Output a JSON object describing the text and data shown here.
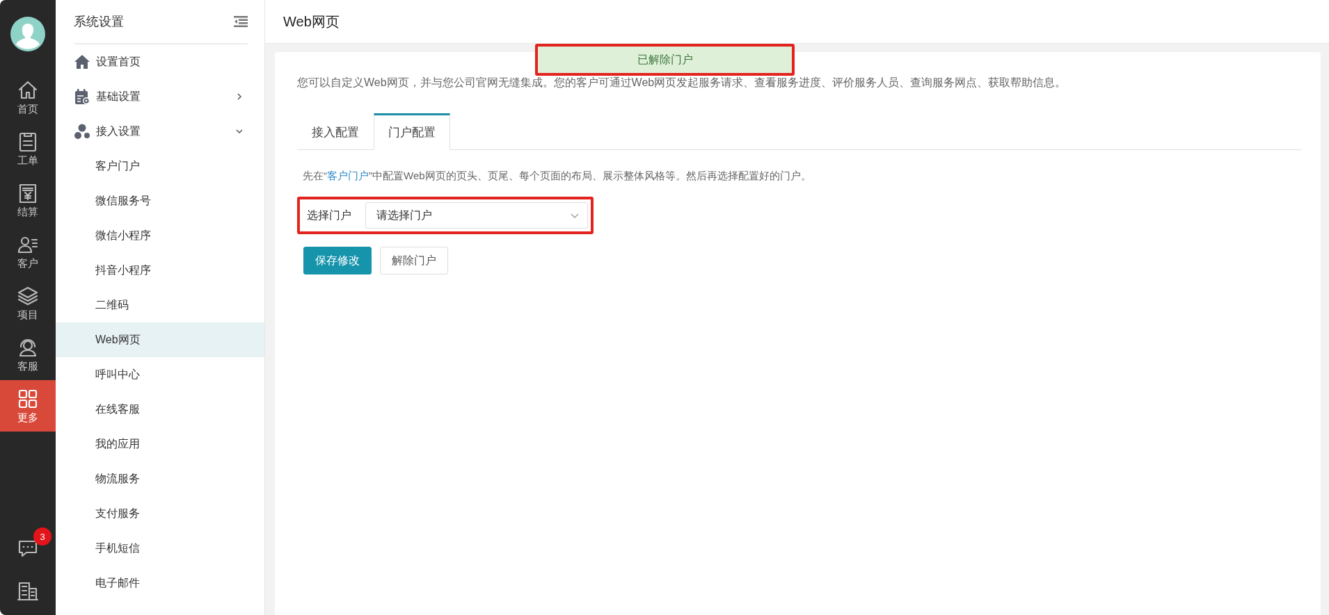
{
  "rail": {
    "items": [
      {
        "label": "首页",
        "kind": "home",
        "selected": false
      },
      {
        "label": "工单",
        "kind": "clipboard",
        "selected": false
      },
      {
        "label": "结算",
        "kind": "invoice",
        "selected": false
      },
      {
        "label": "客户",
        "kind": "customer",
        "selected": false
      },
      {
        "label": "项目",
        "kind": "layers",
        "selected": false
      },
      {
        "label": "客服",
        "kind": "headset",
        "selected": false
      },
      {
        "label": "更多",
        "kind": "grid",
        "selected": true
      }
    ],
    "bottom": [
      {
        "kind": "chat",
        "badge": "3"
      },
      {
        "kind": "building"
      }
    ]
  },
  "sidebar": {
    "title": "系统设置",
    "items": [
      {
        "label": "设置首页",
        "kind": "home",
        "selected": false
      },
      {
        "label": "基础设置",
        "kind": "basic",
        "expanded": false,
        "selected": false
      },
      {
        "label": "接入设置",
        "kind": "access",
        "expanded": true,
        "selected": false,
        "children": [
          {
            "label": "客户门户",
            "selected": false
          },
          {
            "label": "微信服务号",
            "selected": false
          },
          {
            "label": "微信小程序",
            "selected": false
          },
          {
            "label": "抖音小程序",
            "selected": false
          },
          {
            "label": "二维码",
            "selected": false
          },
          {
            "label": "Web网页",
            "selected": true
          },
          {
            "label": "呼叫中心",
            "selected": false
          },
          {
            "label": "在线客服",
            "selected": false
          },
          {
            "label": "我的应用",
            "selected": false
          },
          {
            "label": "物流服务",
            "selected": false
          },
          {
            "label": "支付服务",
            "selected": false
          },
          {
            "label": "手机短信",
            "selected": false
          },
          {
            "label": "电子邮件",
            "selected": false
          }
        ]
      }
    ]
  },
  "page": {
    "title": "Web网页",
    "toast": {
      "text": "已解除门户",
      "highlighted": true
    },
    "description": "您可以自定义Web网页，并与您公司官网无缝集成。您的客户可通过Web网页发起服务请求、查看服务进度、评价服务人员、查询服务网点、获取帮助信息。",
    "tabs": [
      {
        "label": "接入配置",
        "selected": false
      },
      {
        "label": "门户配置",
        "selected": true
      }
    ],
    "hint": {
      "before": "先在“",
      "link": "客户门户",
      "after": "”中配置Web网页的页头、页尾、每个页面的布局、展示整体风格等。然后再选择配置好的门户。"
    },
    "portal_select": {
      "label": "选择门户",
      "placeholder": "请选择门户",
      "highlighted": true
    },
    "buttons": [
      {
        "label": "保存修改",
        "kind": "primary"
      },
      {
        "label": "解除门户",
        "kind": "default"
      }
    ]
  }
}
